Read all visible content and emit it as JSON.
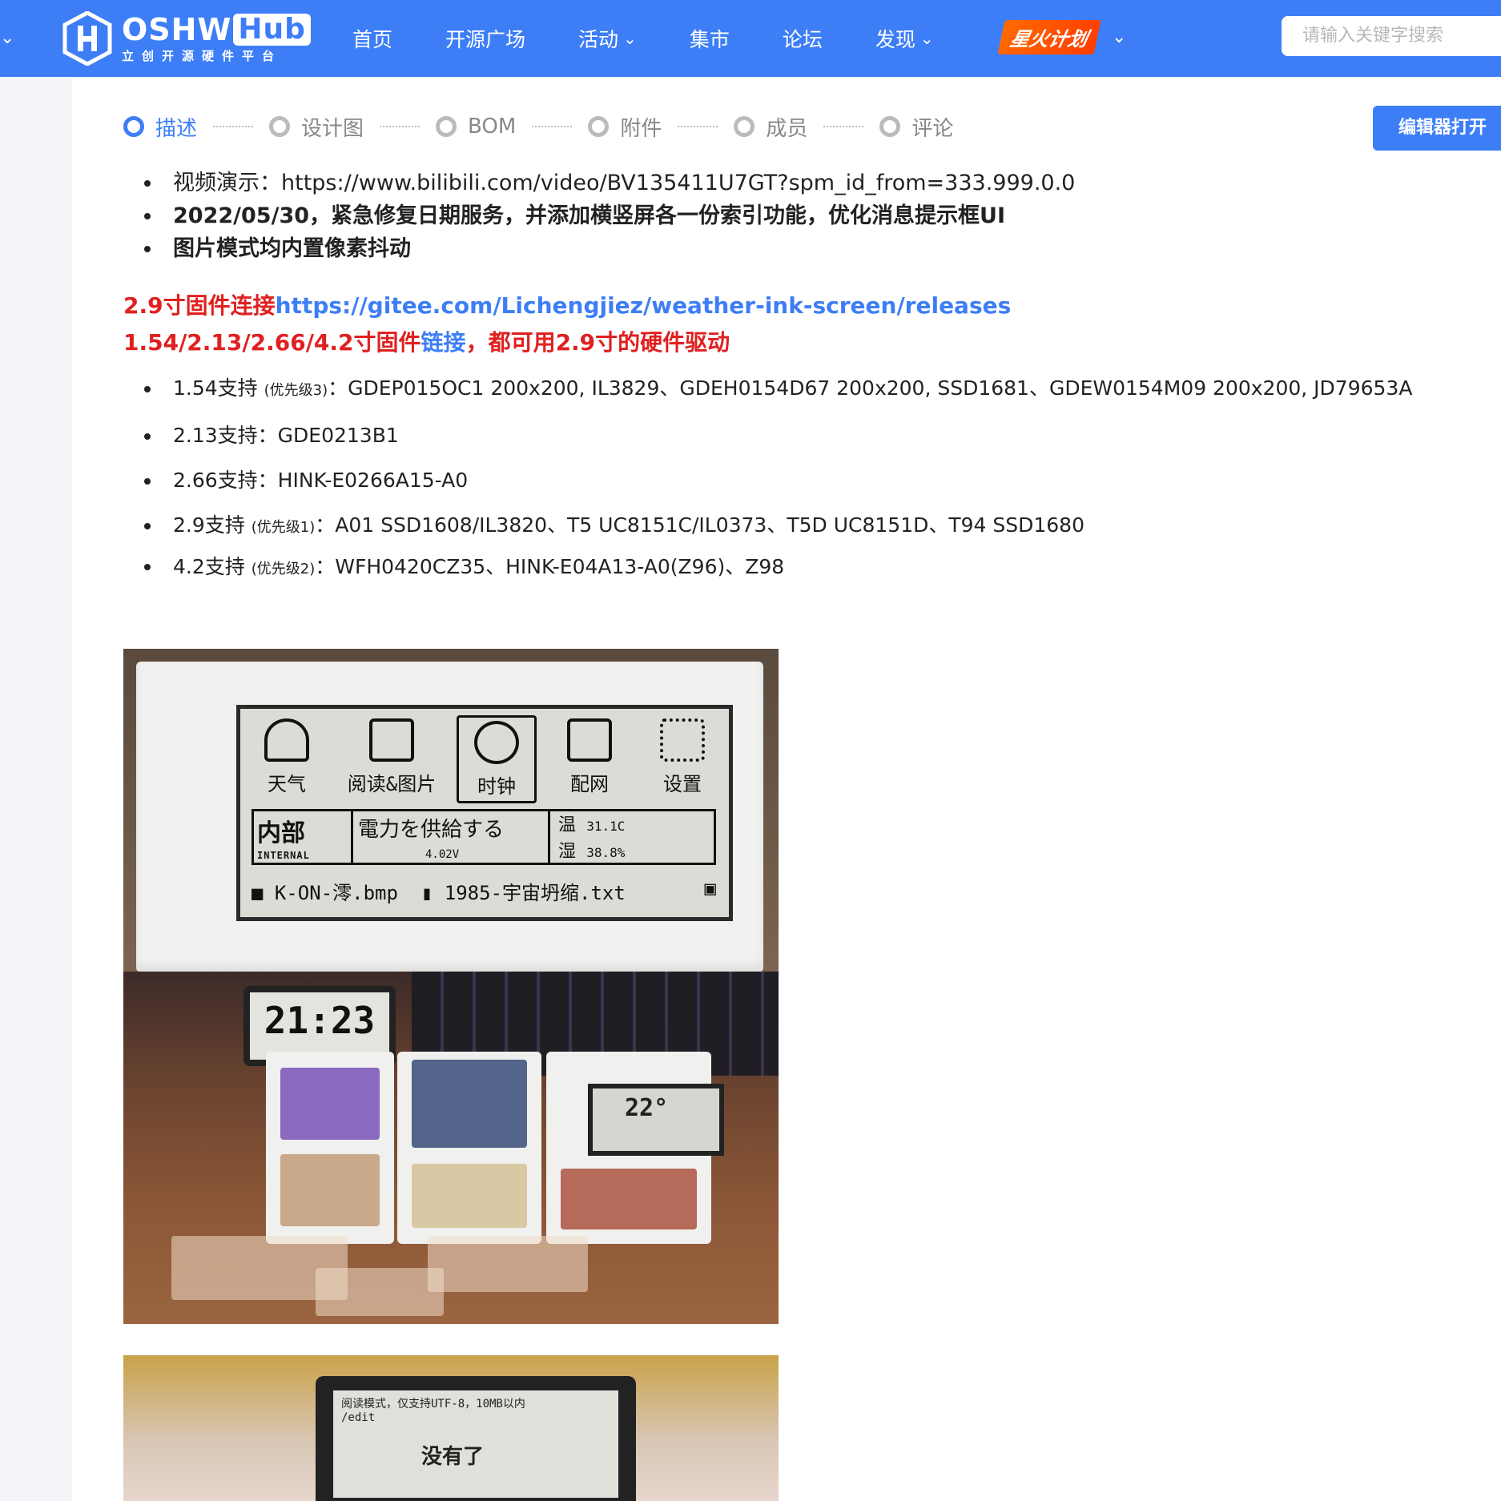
{
  "nav": {
    "logo_text": "OSHW",
    "logo_hub": "Hub",
    "logo_sub": "立创开源硬件平台",
    "items": [
      {
        "label": "首页",
        "dropdown": false
      },
      {
        "label": "开源广场",
        "dropdown": false
      },
      {
        "label": "活动",
        "dropdown": true
      },
      {
        "label": "集市",
        "dropdown": false
      },
      {
        "label": "论坛",
        "dropdown": false
      },
      {
        "label": "发现",
        "dropdown": true
      }
    ],
    "spark_label": "星火计划",
    "search_placeholder": "请输入关键字搜索"
  },
  "steps": [
    "描述",
    "设计图",
    "BOM",
    "附件",
    "成员",
    "评论"
  ],
  "editor_button": "编辑器打开",
  "intro_bullets": [
    {
      "text": "视频演示：https://www.bilibili.com/video/BV135411U7GT?spm_id_from=333.999.0.0",
      "bold": false
    },
    {
      "text": "2022/05/30，紧急修复日期服务，并添加横竖屏各一份索引功能，优化消息提示框UI",
      "bold": true
    },
    {
      "text": "图片模式均内置像素抖动",
      "bold": true
    }
  ],
  "firmware": {
    "line1_red": "2.9寸固件连接",
    "line1_link": "https://gitee.com/Lichengjiez/weather-ink-screen/releases",
    "line2_red_a": "1.54/2.13/2.66/4.2寸固件",
    "line2_link": "链接",
    "line2_red_b": "，都可用2.9寸的硬件驱动"
  },
  "support": [
    {
      "label": "1.54支持",
      "note": "(优先级3)",
      "text": "：GDEP015OC1 200x200, IL3829、GDEH0154D67 200x200, SSD1681、GDEW0154M09 200x200, JD79653A"
    },
    {
      "label": "2.13支持",
      "note": "",
      "text": "：GDE0213B1"
    },
    {
      "label": "2.66支持",
      "note": "",
      "text": "：HINK-E0266A15-A0"
    },
    {
      "label": "2.9支持",
      "note": "(优先级1)",
      "text": "：A01 SSD1608/IL3820、T5 UC8151C/IL0373、T5D UC8151D、T94 SSD1680"
    },
    {
      "label": "4.2支持",
      "note": "(优先级2)",
      "text": "：WFH0420CZ35、HINK-E04A13-A0(Z96)、Z98"
    }
  ],
  "photo1": {
    "menu": [
      "天气",
      "阅读&图片",
      "时钟",
      "配网",
      "设置"
    ],
    "internal_big": "内部",
    "internal_small": "INTERNAL",
    "power_text": "電力を供給する",
    "voltage": "4.02V",
    "temp_label": "温",
    "temp_value": "31.1C",
    "hum_label": "湿",
    "hum_value": "38.8%",
    "file1": "K-ON-澪.bmp",
    "file2": "1985-宇宙坍缩.txt"
  },
  "photo2": {
    "clock": "21:23",
    "weather_temp": "22°"
  },
  "photo3": {
    "line1": "阅读模式，仅支持UTF-8，10MB以内",
    "line2": "/edit",
    "big": "没有了"
  },
  "colors": {
    "brand_blue": "#3d7ef7",
    "alert_red": "#e02020",
    "spark_orange": "#ff5a00"
  }
}
